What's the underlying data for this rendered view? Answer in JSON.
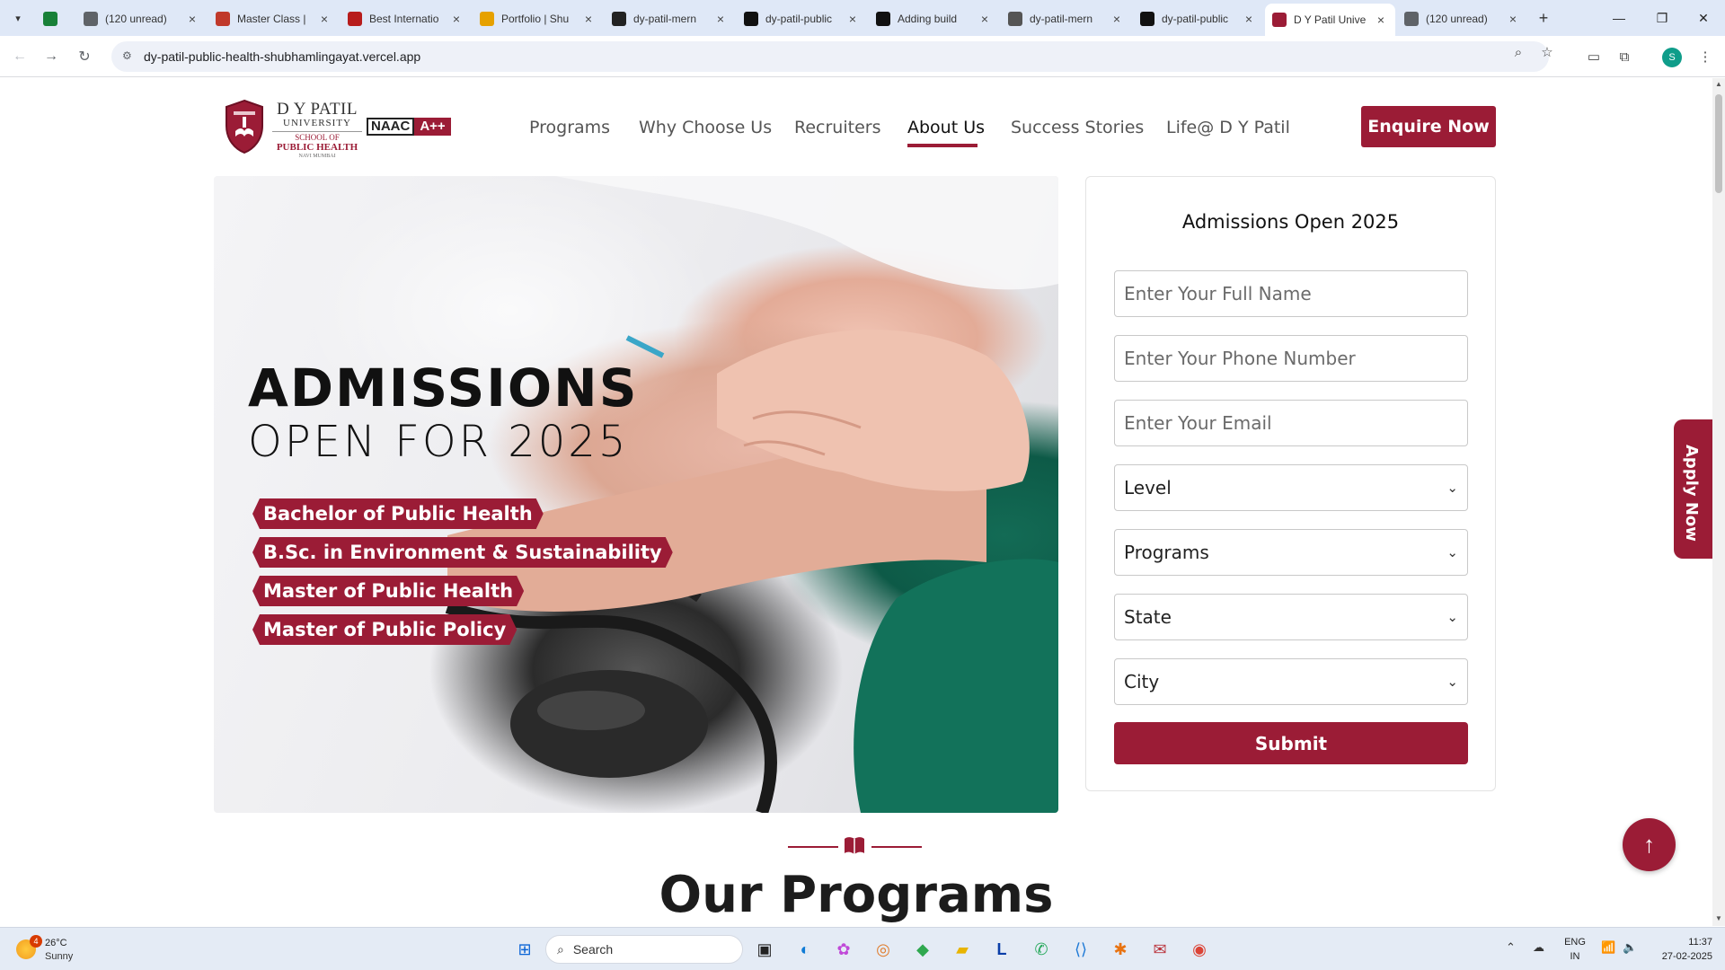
{
  "browser": {
    "tabs": [
      {
        "title": "",
        "icon": "sheets-icon",
        "color": "#188038"
      },
      {
        "title": "(120 unread)",
        "icon": "mail-icon",
        "color": "#5f6368"
      },
      {
        "title": "Master Class |",
        "icon": "masterclass-icon",
        "color": "#c0392b"
      },
      {
        "title": "Best Internatio",
        "icon": "school-icon",
        "color": "#b71c1c"
      },
      {
        "title": "Portfolio | Shu",
        "icon": "portfolio-icon",
        "color": "#e6a100"
      },
      {
        "title": "dy-patil-mern",
        "icon": "deploy-icon",
        "color": "#222"
      },
      {
        "title": "dy-patil-public",
        "icon": "github-icon",
        "color": "#111"
      },
      {
        "title": "Adding build",
        "icon": "openai-icon",
        "color": "#111"
      },
      {
        "title": "dy-patil-mern",
        "icon": "globe-icon",
        "color": "#555"
      },
      {
        "title": "dy-patil-public",
        "icon": "vercel-icon",
        "color": "#111"
      },
      {
        "title": "D Y Patil Unive",
        "icon": "dypatil-icon",
        "color": "#9b1c36"
      },
      {
        "title": "(120 unread)",
        "icon": "mail-icon",
        "color": "#5f6368"
      }
    ],
    "url": "dy-patil-public-health-shubhamlingayat.vercel.app",
    "profile_initial": "S"
  },
  "site": {
    "logo": {
      "line1": "D Y PATIL",
      "line2": "UNIVERSITY",
      "line3": "SCHOOL OF",
      "line4": "PUBLIC HEALTH",
      "line5": "NAVI MUMBAI",
      "naac_label": "NAAC",
      "naac_grade": "A++"
    },
    "nav": [
      {
        "label": "Programs"
      },
      {
        "label": "Why Choose Us"
      },
      {
        "label": "Recruiters"
      },
      {
        "label": "About Us",
        "active": true
      },
      {
        "label": "Success Stories"
      },
      {
        "label": "Life@ D Y Patil"
      }
    ],
    "enquire_label": "Enquire Now",
    "hero": {
      "heading": "ADMISSIONS",
      "subheading": "OPEN FOR 2025",
      "programs": [
        "Bachelor of Public Health",
        "B.Sc. in Environment & Sustainability",
        "Master of Public Health",
        "Master of Public Policy"
      ]
    },
    "form": {
      "title": "Admissions Open 2025",
      "name_placeholder": "Enter Your Full Name",
      "phone_placeholder": "Enter Your Phone Number",
      "email_placeholder": "Enter Your Email",
      "level": "Level",
      "programs": "Programs",
      "state": "State",
      "city": "City",
      "submit": "Submit"
    },
    "apply_now": "Apply Now",
    "section_title": "Our Programs",
    "brand_color": "#9b1c36"
  },
  "taskbar": {
    "weather_temp": "26°C",
    "weather_desc": "Sunny",
    "weather_badge": "4",
    "search_label": "Search",
    "lang_line1": "ENG",
    "lang_line2": "IN",
    "time": "11:37",
    "date": "27-02-2025"
  }
}
